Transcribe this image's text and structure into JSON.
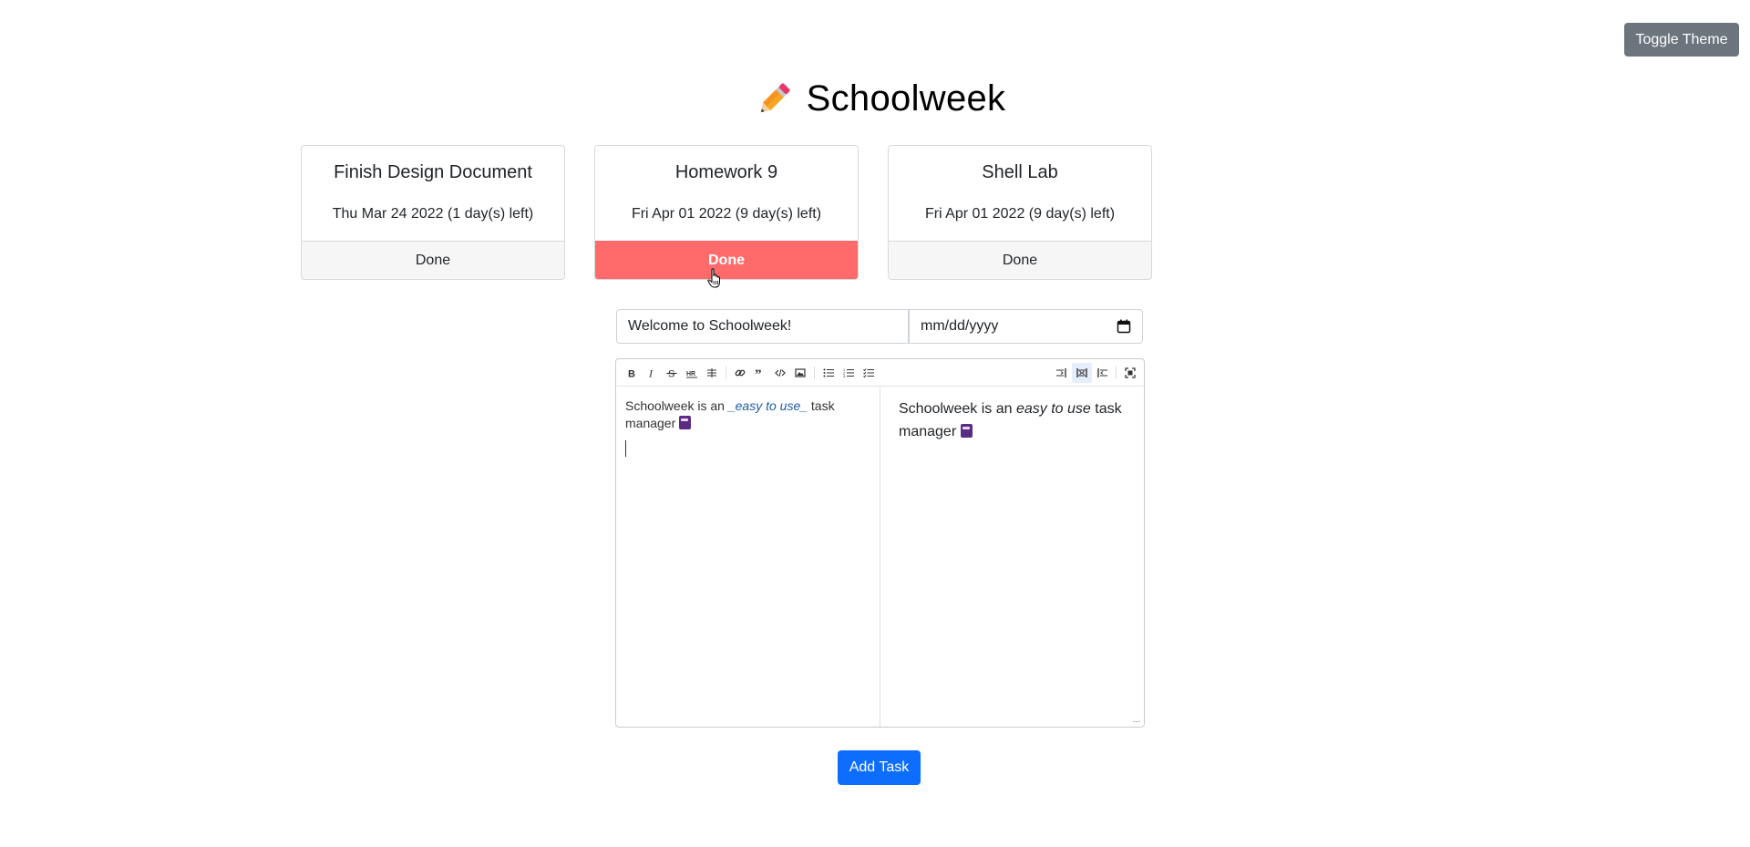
{
  "header": {
    "toggle_theme_label": "Toggle Theme",
    "title": "Schoolweek",
    "logo_icon": "pencil-icon"
  },
  "cards": [
    {
      "title": "Finish Design Document",
      "date": "Thu Mar 24 2022 (1 day(s) left)",
      "button": "Done",
      "hovered": false
    },
    {
      "title": "Homework 9",
      "date": "Fri Apr 01 2022 (9 day(s) left)",
      "button": "Done",
      "hovered": true
    },
    {
      "title": "Shell Lab",
      "date": "Fri Apr 01 2022 (9 day(s) left)",
      "button": "Done",
      "hovered": false
    }
  ],
  "form": {
    "task_name_value": "Welcome to Schoolweek!",
    "date_placeholder": "mm/dd/yyyy",
    "editor": {
      "source_prefix": "Schoolweek is an ",
      "source_emphasis": "_easy to use_",
      "source_suffix": " task manager",
      "preview_prefix": "Schoolweek is an ",
      "preview_emphasis": "easy to use",
      "preview_suffix": " task manager",
      "resize_glyph": "...",
      "toolbar_left": [
        "bold-icon",
        "italic-icon",
        "strikethrough-icon",
        "heading-icon",
        "heading-smaller-icon",
        "link-icon",
        "quote-icon",
        "code-icon",
        "image-icon",
        "unordered-list-icon",
        "ordered-list-icon",
        "checklist-icon"
      ],
      "toolbar_right": [
        "edit-only-icon",
        "side-by-side-icon",
        "preview-only-icon",
        "fullscreen-icon"
      ]
    },
    "add_task_label": "Add Task"
  },
  "colors": {
    "done_hover": "#ff6b6b",
    "primary": "#0d6efd",
    "secondary": "#6c757d"
  }
}
